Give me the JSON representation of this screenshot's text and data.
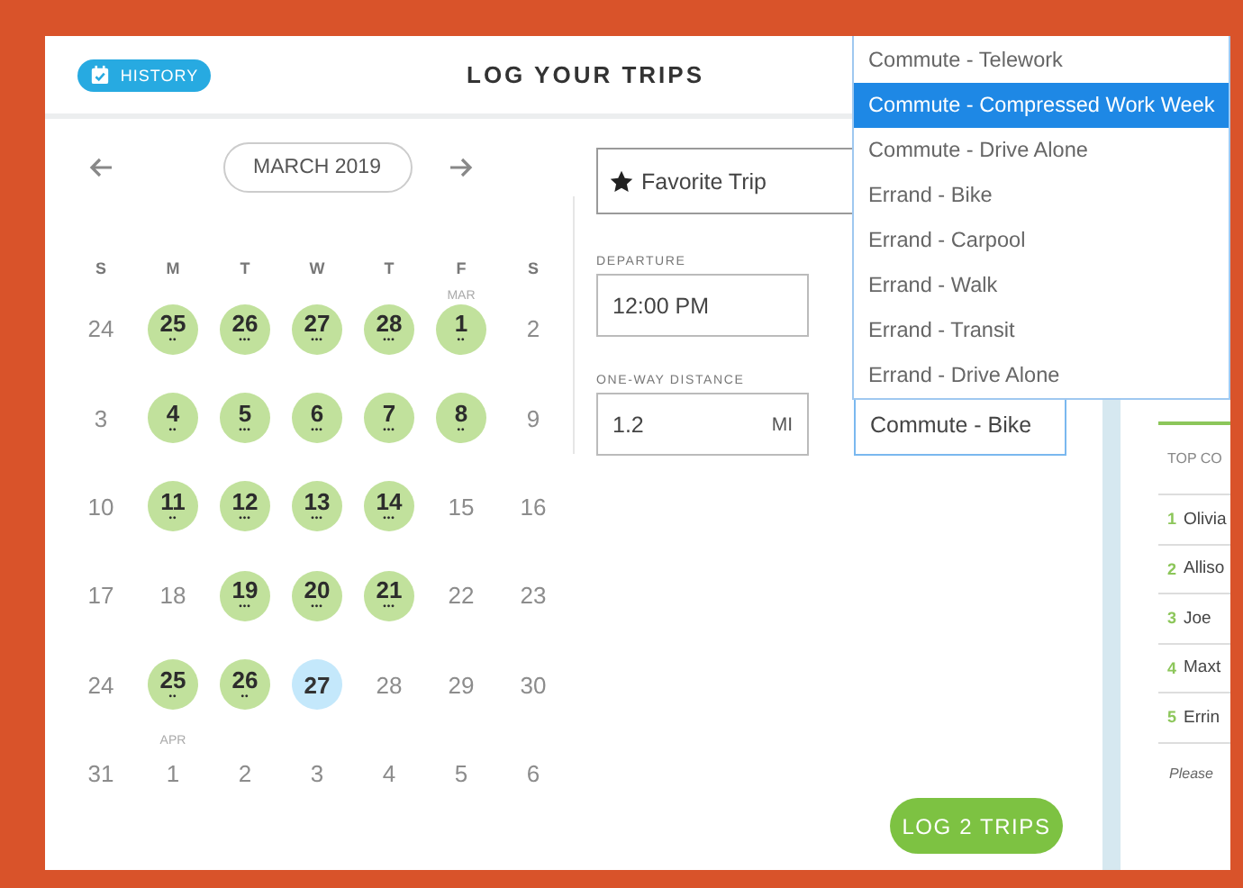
{
  "header": {
    "history_button": "HISTORY",
    "title": "LOG YOUR TRIPS"
  },
  "calendar": {
    "month": "MARCH 2019",
    "weekdays": [
      "S",
      "M",
      "T",
      "W",
      "T",
      "F",
      "S"
    ],
    "weeks": [
      [
        {
          "day": "24",
          "kind": "plain"
        },
        {
          "day": "25",
          "kind": "logged",
          "marks": "••"
        },
        {
          "day": "26",
          "kind": "logged",
          "marks": "•••"
        },
        {
          "day": "27",
          "kind": "logged",
          "marks": "•••"
        },
        {
          "day": "28",
          "kind": "logged",
          "marks": "•••"
        },
        {
          "day": "1",
          "kind": "logged",
          "marks": "••",
          "month_label": "MAR"
        },
        {
          "day": "2",
          "kind": "plain"
        }
      ],
      [
        {
          "day": "3",
          "kind": "plain"
        },
        {
          "day": "4",
          "kind": "logged",
          "marks": "••"
        },
        {
          "day": "5",
          "kind": "logged",
          "marks": "•••"
        },
        {
          "day": "6",
          "kind": "logged",
          "marks": "•••"
        },
        {
          "day": "7",
          "kind": "logged",
          "marks": "•••"
        },
        {
          "day": "8",
          "kind": "logged",
          "marks": "••"
        },
        {
          "day": "9",
          "kind": "plain"
        }
      ],
      [
        {
          "day": "10",
          "kind": "plain"
        },
        {
          "day": "11",
          "kind": "logged",
          "marks": "••"
        },
        {
          "day": "12",
          "kind": "logged",
          "marks": "•••"
        },
        {
          "day": "13",
          "kind": "logged",
          "marks": "•••"
        },
        {
          "day": "14",
          "kind": "logged",
          "marks": "•••"
        },
        {
          "day": "15",
          "kind": "plain"
        },
        {
          "day": "16",
          "kind": "plain"
        }
      ],
      [
        {
          "day": "17",
          "kind": "plain"
        },
        {
          "day": "18",
          "kind": "plain"
        },
        {
          "day": "19",
          "kind": "logged",
          "marks": "•••"
        },
        {
          "day": "20",
          "kind": "logged",
          "marks": "•••"
        },
        {
          "day": "21",
          "kind": "logged",
          "marks": "•••"
        },
        {
          "day": "22",
          "kind": "plain"
        },
        {
          "day": "23",
          "kind": "plain"
        }
      ],
      [
        {
          "day": "24",
          "kind": "plain"
        },
        {
          "day": "25",
          "kind": "logged",
          "marks": "••"
        },
        {
          "day": "26",
          "kind": "logged",
          "marks": "••"
        },
        {
          "day": "27",
          "kind": "today"
        },
        {
          "day": "28",
          "kind": "plain"
        },
        {
          "day": "29",
          "kind": "plain"
        },
        {
          "day": "30",
          "kind": "plain"
        }
      ],
      [
        {
          "day": "31",
          "kind": "plain"
        },
        {
          "day": "1",
          "kind": "plain",
          "month_label": "APR"
        },
        {
          "day": "2",
          "kind": "plain"
        },
        {
          "day": "3",
          "kind": "plain"
        },
        {
          "day": "4",
          "kind": "plain"
        },
        {
          "day": "5",
          "kind": "plain"
        },
        {
          "day": "6",
          "kind": "plain"
        }
      ]
    ]
  },
  "form": {
    "favorite": "Favorite Trip",
    "departure": {
      "label": "DEPARTURE",
      "value": "12:00 PM"
    },
    "distance": {
      "label": "ONE-WAY DISTANCE",
      "value": "1.2",
      "unit": "MI"
    },
    "trip_type": {
      "value": "Commute - Bike",
      "expanded": true,
      "options": [
        {
          "label": "Commute - Telework",
          "selected": false
        },
        {
          "label": "Commute - Compressed Work Week",
          "selected": true
        },
        {
          "label": "Commute - Drive Alone",
          "selected": false
        },
        {
          "label": "Errand - Bike",
          "selected": false
        },
        {
          "label": "Errand - Carpool",
          "selected": false
        },
        {
          "label": "Errand - Walk",
          "selected": false
        },
        {
          "label": "Errand - Transit",
          "selected": false
        },
        {
          "label": "Errand - Drive Alone",
          "selected": false
        }
      ]
    },
    "log_button": "LOG 2 TRIPS"
  },
  "leaderboard": {
    "heading": "TOP CO",
    "rows": [
      {
        "rank": "1",
        "name": "Olivia"
      },
      {
        "rank": "2",
        "name": "Alliso"
      },
      {
        "rank": "3",
        "name": "Joe"
      },
      {
        "rank": "4",
        "name": "Maxt"
      },
      {
        "rank": "5",
        "name": "Errin"
      }
    ],
    "note": "Please"
  }
}
